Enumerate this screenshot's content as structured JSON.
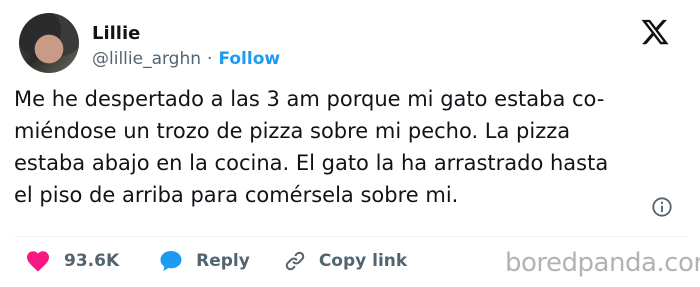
{
  "author": {
    "name": "Lillie",
    "handle": "@lillie_arghn",
    "separator": "·",
    "follow_label": "Follow"
  },
  "tweet": {
    "lines": [
      "Me he despertado a las 3 am porque mi gato estaba co-",
      "miéndose un trozo de pizza sobre mi pecho. La pizza",
      "estaba abajo en la cocina. El gato la ha arrastrado hasta",
      "el piso de arriba para comérsela sobre mi."
    ]
  },
  "actions": {
    "likes": "93.6K",
    "reply_label": "Reply",
    "copy_link_label": "Copy link"
  },
  "icons": {
    "brand": "x-logo-icon",
    "info": "info-icon",
    "like": "heart-icon",
    "reply": "speech-bubble-icon",
    "copy": "link-icon"
  },
  "colors": {
    "heart": "#f91880",
    "reply": "#1d9bf0",
    "follow": "#1d9bf0",
    "muted": "#536471"
  },
  "watermark": "boredpanda.com"
}
